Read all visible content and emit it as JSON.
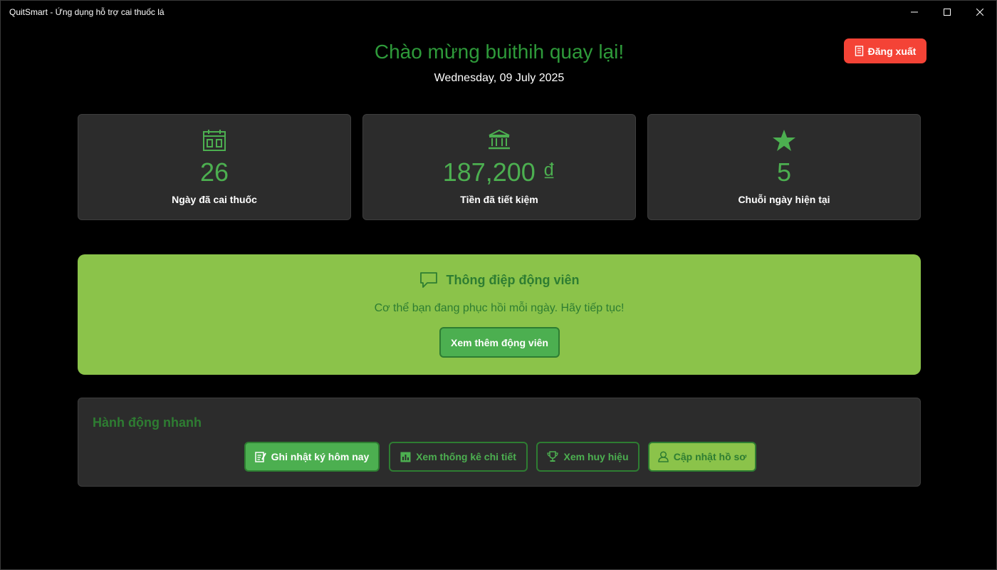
{
  "window": {
    "title": "QuitSmart - Ứng dụng hỗ trợ cai thuốc lá",
    "controls": [
      "minimize-icon",
      "maximize-icon",
      "close-icon"
    ]
  },
  "header": {
    "greeting": "Chào mừng buithih quay lại!",
    "date": "Wednesday, 09 July 2025",
    "logout_label": "Đăng xuất",
    "logout_icon": "door-icon"
  },
  "stats": [
    {
      "icon": "calendar-icon",
      "value": "26",
      "label": "Ngày đã cai thuốc"
    },
    {
      "icon": "bank-icon",
      "value": "187,200 ₫",
      "label": "Tiền đã tiết kiệm"
    },
    {
      "icon": "star-icon",
      "value": "5",
      "label": "Chuỗi ngày hiện tại"
    }
  ],
  "motivation": {
    "icon": "chat-bubble-icon",
    "title": "Thông điệp động viên",
    "message": "Cơ thể bạn đang phục hồi mỗi ngày. Hãy tiếp tục!",
    "button_label": "Xem thêm động viên"
  },
  "quick_actions": {
    "title": "Hành động nhanh",
    "buttons": [
      {
        "icon": "note-edit-icon",
        "label": "Ghi nhật ký hôm nay"
      },
      {
        "icon": "chart-icon",
        "label": "Xem thống kê chi tiết"
      },
      {
        "icon": "trophy-icon",
        "label": "Xem huy hiệu"
      },
      {
        "icon": "user-icon",
        "label": "Cập nhật hồ sơ"
      }
    ]
  },
  "colors": {
    "background": "#000000",
    "card": "#2c2c2c",
    "green": "#4caf50",
    "dark_green": "#2e7d32",
    "light_green": "#8bc34a",
    "red": "#f44336"
  }
}
